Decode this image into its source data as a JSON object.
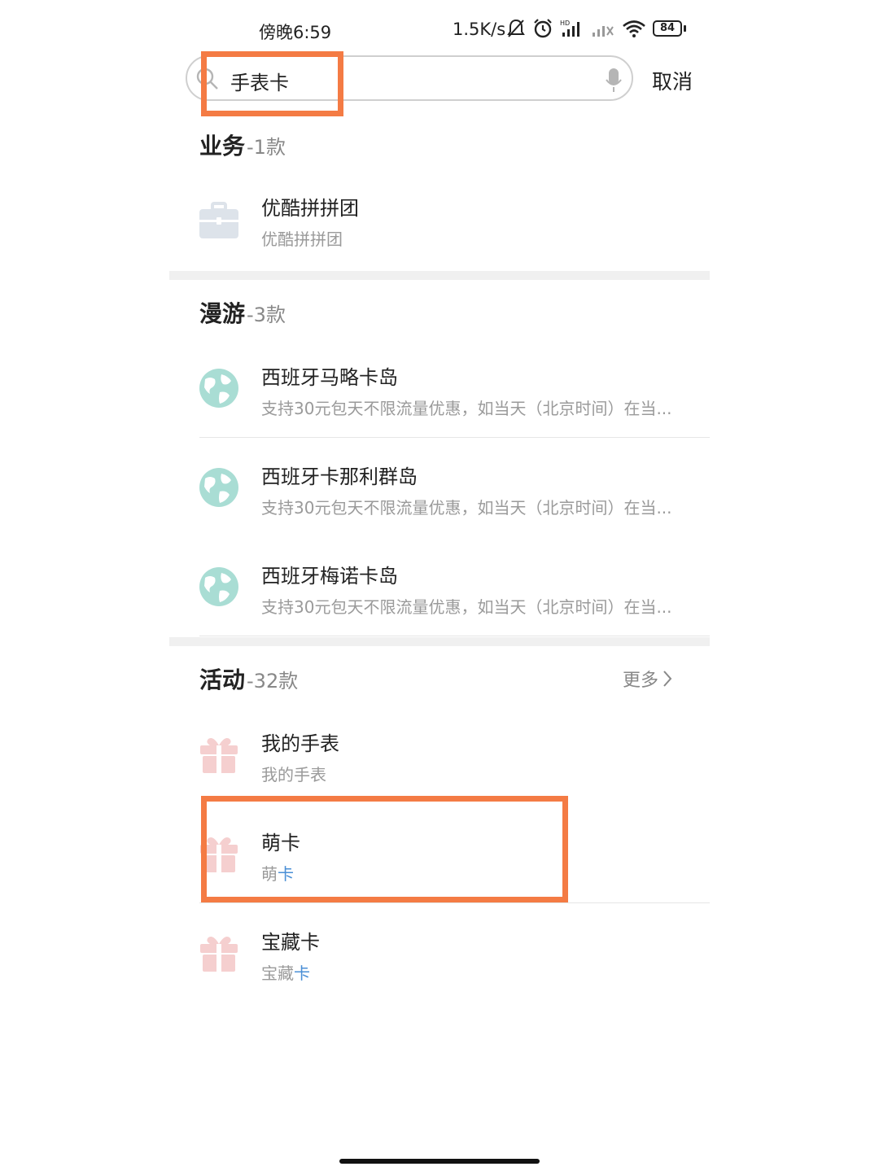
{
  "status_bar": {
    "time": "傍晚6:59",
    "network_speed": "1.5K/s",
    "battery": "84",
    "icons": [
      "bell-muted-icon",
      "alarm-icon",
      "hd-signal-icon",
      "signal-icon",
      "wifi-icon",
      "battery-icon"
    ]
  },
  "search": {
    "query": "手表卡",
    "cancel_label": "取消"
  },
  "sections": {
    "business": {
      "title": "业务",
      "count": "-1款",
      "items": [
        {
          "title": "优酷拼拼团",
          "subtitle": "优酷拼拼团",
          "icon": "briefcase-icon"
        }
      ]
    },
    "roaming": {
      "title": "漫游",
      "count": "-3款",
      "items": [
        {
          "title": "西班牙马略卡岛",
          "subtitle": "支持30元包天不限流量优惠，如当天（北京时间）在当...",
          "icon": "globe-icon"
        },
        {
          "title": "西班牙卡那利群岛",
          "subtitle": "支持30元包天不限流量优惠，如当天（北京时间）在当...",
          "icon": "globe-icon"
        },
        {
          "title": "西班牙梅诺卡岛",
          "subtitle": "支持30元包天不限流量优惠，如当天（北京时间）在当...",
          "icon": "globe-icon"
        }
      ]
    },
    "activity": {
      "title": "活动",
      "count": "-32款",
      "more_label": "更多",
      "items": [
        {
          "title": "我的手表",
          "subtitle": "我的手表",
          "icon": "gift-icon"
        },
        {
          "title": "萌卡",
          "subtitle_plain": "萌",
          "subtitle_match": "卡",
          "icon": "gift-icon"
        },
        {
          "title": "宝藏卡",
          "subtitle_plain": "宝藏",
          "subtitle_match": "卡",
          "icon": "gift-icon"
        }
      ]
    }
  },
  "colors": {
    "highlight": "#f47b44",
    "match_text": "#4a8fd6",
    "globe": "#a9ddd4",
    "gift": "#f5cfcf",
    "briefcase": "#dde3ea"
  }
}
